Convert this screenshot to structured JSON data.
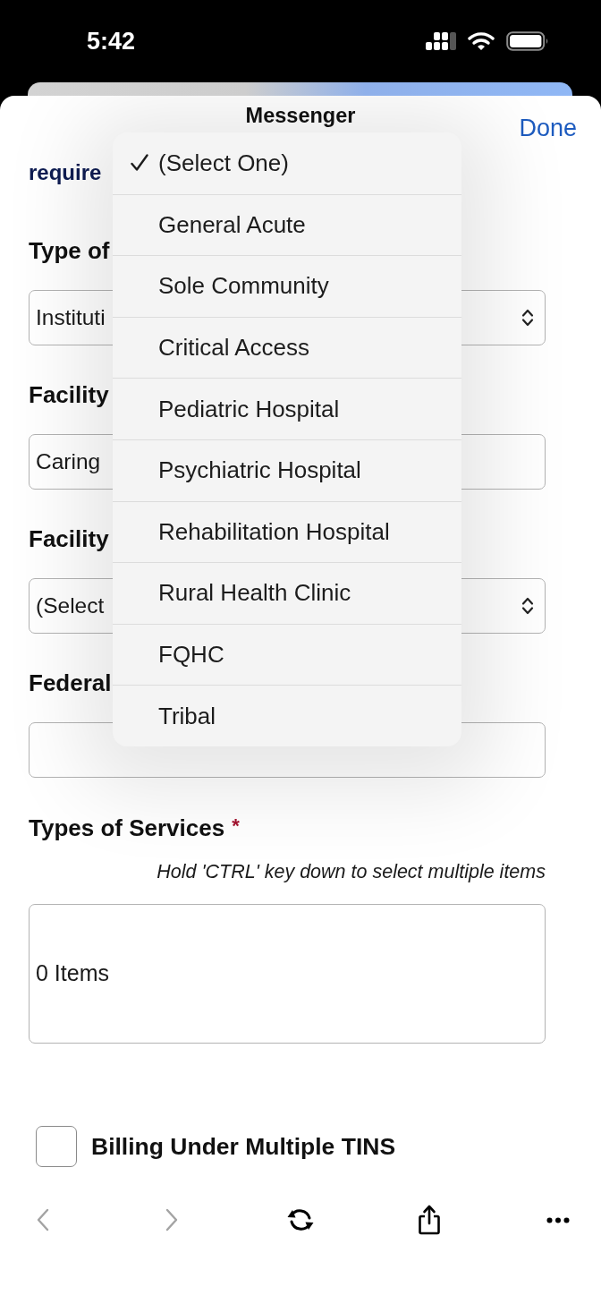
{
  "status_bar": {
    "time": "5:42"
  },
  "sheet": {
    "title": "Messenger",
    "done": "Done"
  },
  "form": {
    "required_note": "require",
    "fields": [
      {
        "kind": "select",
        "label": "Type of",
        "value": "Instituti"
      },
      {
        "kind": "text",
        "label": "Facility",
        "value": "Caring"
      },
      {
        "kind": "select",
        "label": "Facility",
        "value": "(Select"
      },
      {
        "kind": "text",
        "label": "Federal"
      }
    ],
    "services": {
      "label": "Types of Services",
      "required_mark": "*",
      "hint": "Hold 'CTRL' key down to select multiple items",
      "value": "0 Items"
    },
    "checkbox": {
      "label": "Billing Under Multiple TINS",
      "checked": false
    }
  },
  "dropdown": {
    "options": [
      {
        "label": "(Select One)",
        "selected": true
      },
      {
        "label": "General Acute",
        "selected": false
      },
      {
        "label": "Sole Community",
        "selected": false
      },
      {
        "label": "Critical Access",
        "selected": false
      },
      {
        "label": "Pediatric Hospital",
        "selected": false
      },
      {
        "label": "Psychiatric Hospital",
        "selected": false
      },
      {
        "label": "Rehabilitation Hospital",
        "selected": false
      },
      {
        "label": "Rural Health Clinic",
        "selected": false
      },
      {
        "label": "FQHC",
        "selected": false
      },
      {
        "label": "Tribal",
        "selected": false
      }
    ]
  },
  "toolbar": [
    {
      "kind": "back",
      "disabled": true
    },
    {
      "kind": "forward",
      "disabled": true
    },
    {
      "kind": "reload",
      "disabled": false
    },
    {
      "kind": "share",
      "disabled": false
    },
    {
      "kind": "more",
      "disabled": false
    }
  ]
}
